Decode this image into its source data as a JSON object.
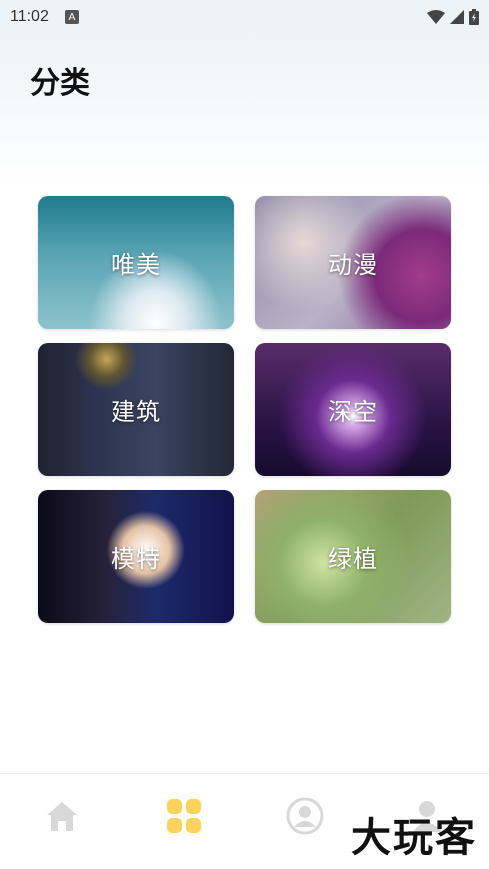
{
  "status_bar": {
    "time": "11:02",
    "notification_icon": "A",
    "icons": [
      "wifi-icon",
      "signal-icon",
      "battery-icon"
    ]
  },
  "header": {
    "title": "分类"
  },
  "categories": [
    {
      "label": "唯美",
      "icon": "sky-clouds-image"
    },
    {
      "label": "动漫",
      "icon": "anime-image"
    },
    {
      "label": "建筑",
      "icon": "clock-tower-image"
    },
    {
      "label": "深空",
      "icon": "nebula-image"
    },
    {
      "label": "模特",
      "icon": "model-image"
    },
    {
      "label": "绿植",
      "icon": "succulent-image"
    }
  ],
  "bottom_nav": {
    "items": [
      {
        "name": "home",
        "icon": "home-icon",
        "active": false
      },
      {
        "name": "category",
        "icon": "grid-icon",
        "active": true
      },
      {
        "name": "profile",
        "icon": "avatar-icon",
        "active": false
      },
      {
        "name": "user",
        "icon": "person-icon",
        "active": false
      }
    ],
    "active_color": "#f9d35b",
    "inactive_color": "#d8d8d8"
  },
  "watermark": "大玩客"
}
